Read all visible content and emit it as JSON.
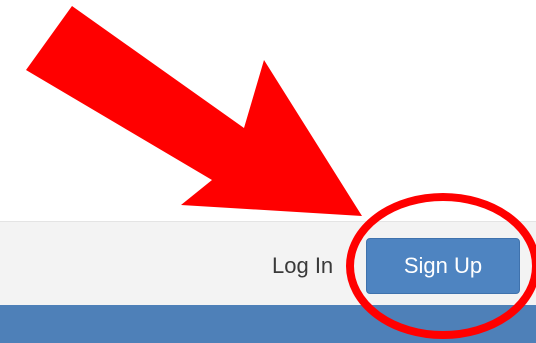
{
  "header": {
    "login_label": "Log In",
    "signup_label": "Sign Up"
  },
  "colors": {
    "header_background": "#f3f3f3",
    "nav_strip": "#4e80b8",
    "signup_button": "#4e84c1",
    "annotation_red": "#ff0000"
  },
  "annotations": {
    "arrow_icon": "red-arrow-icon",
    "circle_icon": "red-circle-highlight-icon"
  }
}
